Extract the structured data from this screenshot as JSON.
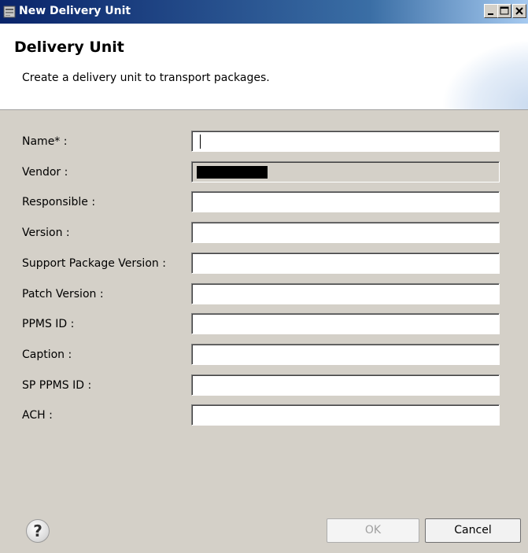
{
  "window": {
    "title": "New Delivery Unit",
    "icon": "dialog-app-icon",
    "controls": [
      "minimize-icon",
      "maximize-icon",
      "close-icon"
    ]
  },
  "header": {
    "title": "Delivery Unit",
    "description": "Create a delivery unit to transport packages."
  },
  "form": {
    "fields": [
      {
        "label": "Name* :",
        "value": "",
        "editable": true,
        "focused": true
      },
      {
        "label": "Vendor :",
        "value": "",
        "editable": false,
        "redacted": true
      },
      {
        "label": "Responsible :",
        "value": "",
        "editable": true
      },
      {
        "label": "Version :",
        "value": "",
        "editable": true
      },
      {
        "label": "Support Package Version :",
        "value": "",
        "editable": true
      },
      {
        "label": "Patch Version :",
        "value": "",
        "editable": true
      },
      {
        "label": "PPMS ID :",
        "value": "",
        "editable": true
      },
      {
        "label": "Caption :",
        "value": "",
        "editable": true
      },
      {
        "label": "SP PPMS ID :",
        "value": "",
        "editable": true
      },
      {
        "label": "ACH :",
        "value": "",
        "editable": true
      }
    ]
  },
  "footer": {
    "help_icon": "question-mark",
    "help_glyph": "?",
    "ok_label": "OK",
    "ok_enabled": false,
    "cancel_label": "Cancel"
  }
}
